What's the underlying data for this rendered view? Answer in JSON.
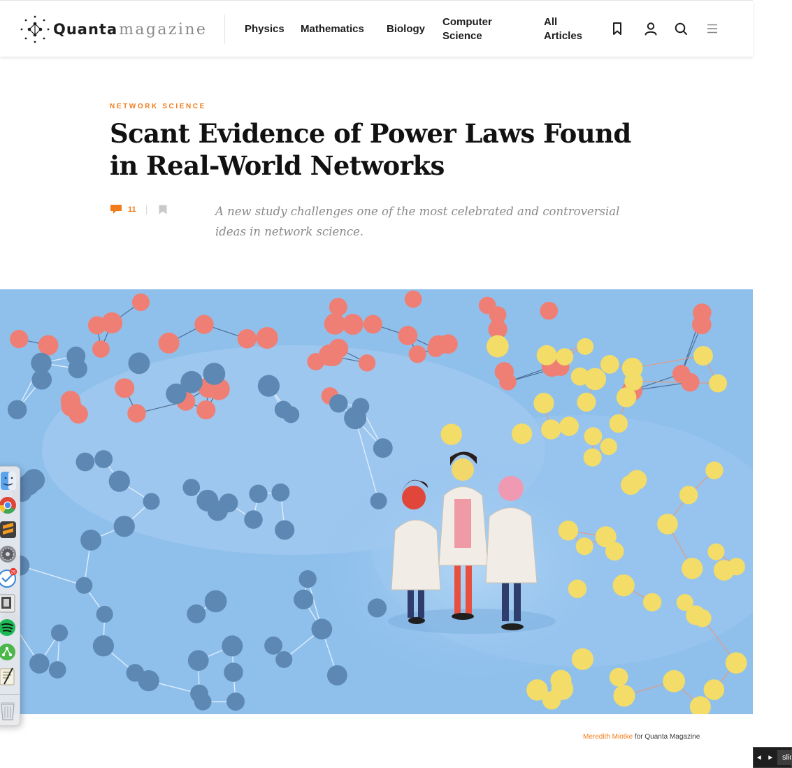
{
  "header": {
    "logo_word_primary": "Quanta",
    "logo_word_secondary": "magazine",
    "nav": {
      "physics": "Physics",
      "mathematics": "Mathematics",
      "biology": "Biology",
      "computer_science_line1": "Computer",
      "computer_science_line2": "Science",
      "all_articles_line1": "All",
      "all_articles_line2": "Articles"
    },
    "icons": [
      "bookmark-icon",
      "user-icon",
      "search-icon",
      "menu-icon"
    ]
  },
  "article": {
    "kicker": "NETWORK SCIENCE",
    "title": "Scant Evidence of Power Laws Found in Real-World Networks",
    "comment_count": "11",
    "dek": "A new study challenges one of the most celebrated and controversial ideas in network science."
  },
  "hero": {
    "caption_credit": "Meredith Miotke",
    "caption_rest": " for Quanta Magazine"
  },
  "dock": {
    "items": [
      "finder-icon",
      "chrome-icon",
      "sublime-text-icon",
      "system-preferences-icon",
      "airmail-icon",
      "preview-icon",
      "spotify-icon",
      "sourcetree-icon",
      "script-editor-icon",
      "trash-icon"
    ],
    "airmail_badge": "29"
  },
  "slide_widget": {
    "arrows": "◄ ►",
    "label": "slides"
  },
  "colors": {
    "accent": "#f27c1a",
    "text": "#111111",
    "muted": "#8a8a8a",
    "hero_sky": "#8fc0ec",
    "node_red": "#ef7f74",
    "node_blue": "#5e88b4",
    "node_yellow": "#f3dc67"
  }
}
